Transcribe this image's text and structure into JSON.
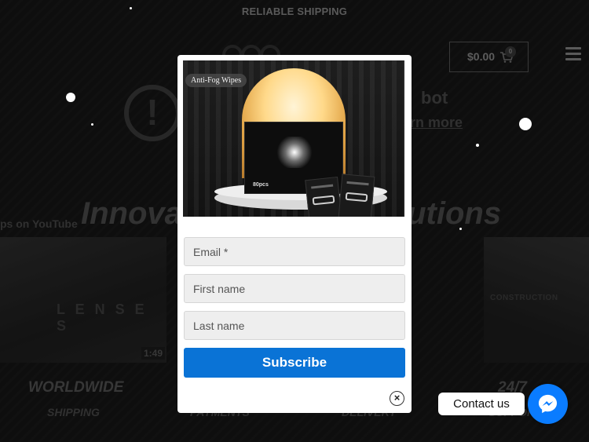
{
  "topbar": {
    "text": "RELIABLE SHIPPING"
  },
  "header": {
    "cart_total": "$0.00",
    "cart_count": "0"
  },
  "notice": {
    "text": "bot",
    "link": "rn more"
  },
  "hero": {
    "headline_start": "Innova",
    "headline_end": "lutions"
  },
  "videos": {
    "youtube_label": "ps on YouTube",
    "left_caption": "L E N S E S",
    "left_duration": "1:49",
    "right_caption": "CONSTRUCTION"
  },
  "features": [
    {
      "title": "WORLDWIDE",
      "subtitle": "SHIPPING"
    },
    {
      "title": "",
      "subtitle": "PAYMENTS"
    },
    {
      "title": "",
      "subtitle": "DELIVERY"
    },
    {
      "title": "24/7",
      "subtitle": "SUPPORT"
    }
  ],
  "popup": {
    "product_tag": "Anti-Fog Wipes",
    "box_label": "80pcs",
    "email_placeholder": "Email *",
    "first_name_placeholder": "First name",
    "last_name_placeholder": "Last name",
    "subscribe_label": "Subscribe",
    "close_symbol": "×"
  },
  "chat": {
    "contact_label": "Contact us"
  },
  "colors": {
    "accent": "#0a73d6",
    "messenger": "#0a7cff",
    "background": "#161616"
  },
  "icons": [
    "cart-icon",
    "menu-icon",
    "alert-icon",
    "close-icon",
    "messenger-icon"
  ]
}
